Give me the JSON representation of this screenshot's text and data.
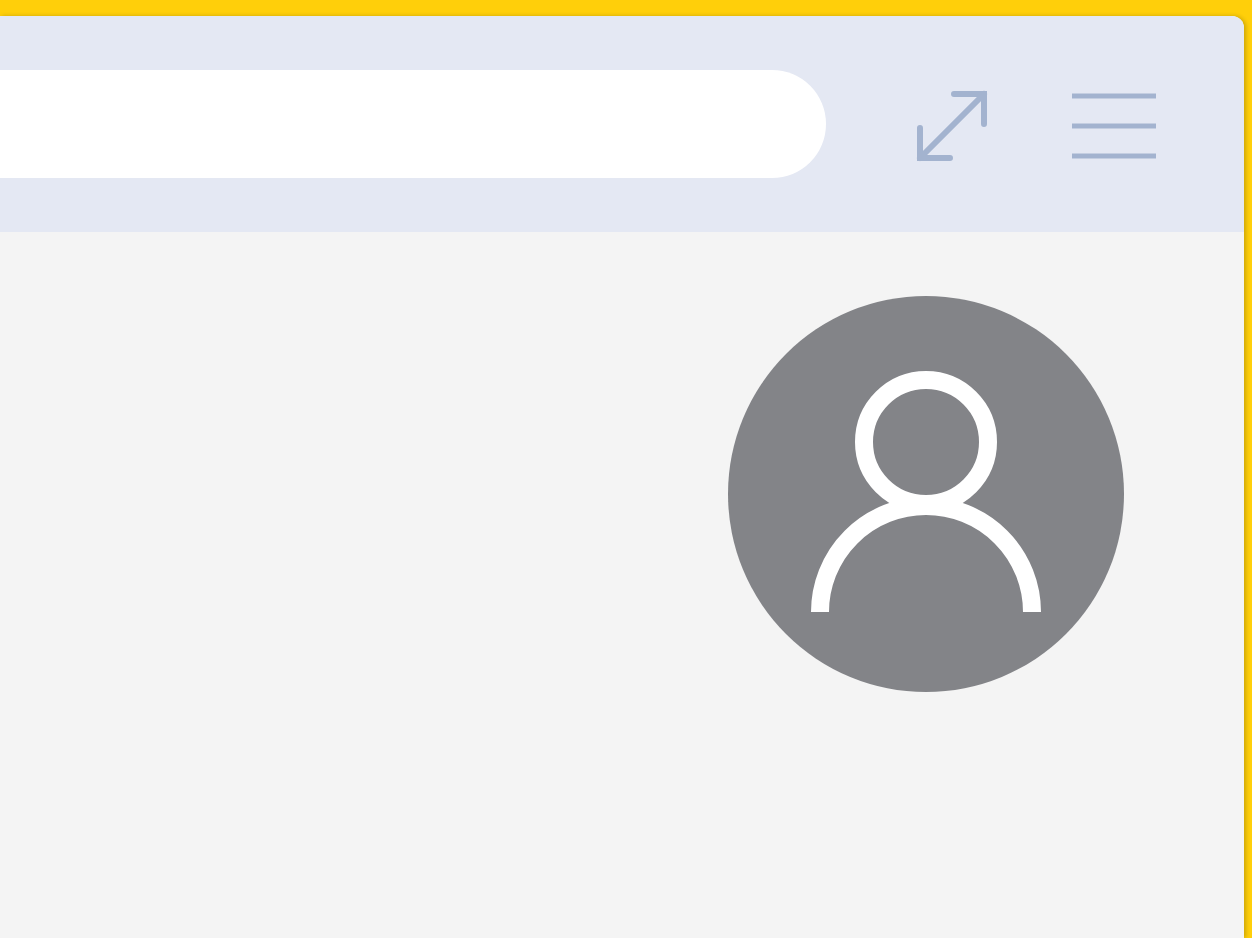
{
  "address_bar": {
    "kind": "field"
  },
  "avatar": {
    "kind": "generic"
  }
}
